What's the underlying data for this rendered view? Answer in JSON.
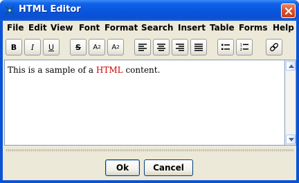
{
  "window": {
    "title": "HTML Editor",
    "icon": "html-editor-app-icon",
    "close_icon": "close-icon"
  },
  "menubar": {
    "items": [
      "File",
      "Edit",
      "View",
      "Font",
      "Format",
      "Search",
      "Insert",
      "Table",
      "Forms",
      "Help"
    ]
  },
  "toolbar": {
    "bold_label": "B",
    "italic_label": "I",
    "underline_label": "U",
    "strike_label": "S",
    "superscript_label": "A",
    "superscript_mark": "2",
    "subscript_label": "A",
    "subscript_mark": "2",
    "icons": [
      "align-left-icon",
      "align-center-icon",
      "align-right-icon",
      "align-justify-icon",
      "bullet-list-icon",
      "numbered-list-icon",
      "link-icon"
    ]
  },
  "editor": {
    "text_before": "This is a sample of a ",
    "text_highlight": "HTML",
    "text_after": " content.",
    "highlight_color": "#cc0000"
  },
  "buttons": {
    "ok_label": "Ok",
    "cancel_label": "Cancel"
  },
  "colors": {
    "titlebar": "#0a55dd",
    "client_bg": "#ece9d8",
    "close_button": "#d94f28"
  }
}
